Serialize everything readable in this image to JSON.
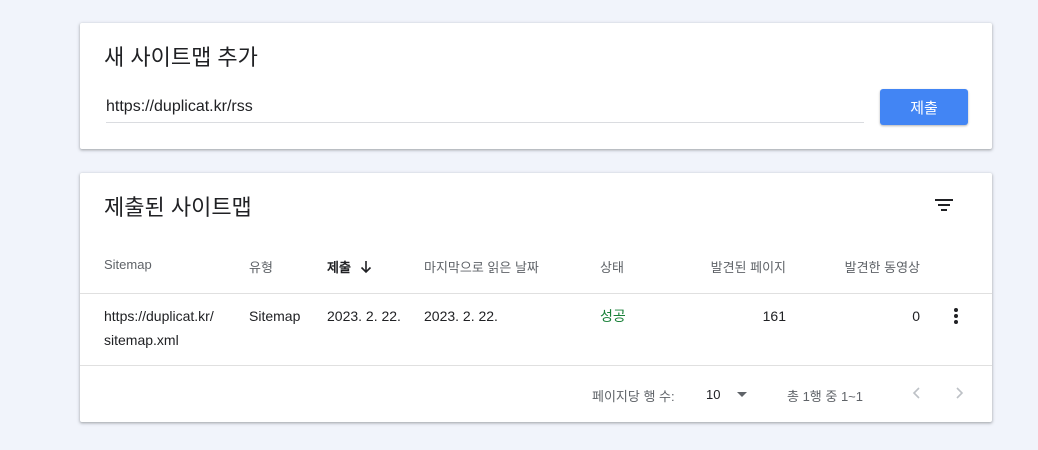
{
  "add_sitemap": {
    "title": "새 사이트맵 추가",
    "input_value": "https://duplicat.kr/rss",
    "submit_label": "제출"
  },
  "submitted": {
    "title": "제출된 사이트맵",
    "columns": [
      "Sitemap",
      "유형",
      "제출",
      "마지막으로 읽은 날짜",
      "상태",
      "발견된 페이지",
      "발견한 동영상"
    ],
    "sort_column": "제출",
    "rows": [
      {
        "sitemap_line1": "https://duplicat.kr/",
        "sitemap_line2": "sitemap.xml",
        "type": "Sitemap",
        "submitted": "2023. 2. 22.",
        "last_read": "2023. 2. 22.",
        "status": "성공",
        "pages": "161",
        "videos": "0"
      }
    ],
    "footer": {
      "rows_per_page_label": "페이지당 행 수:",
      "rows_per_page_value": "10",
      "range_text": "총 1행 중 1~1"
    }
  },
  "colors": {
    "accent": "#4285f4",
    "success": "#188038",
    "background": "#f1f4fb"
  },
  "icons": [
    "filter-icon",
    "arrow-down-icon",
    "more-vert-icon",
    "dropdown-caret-icon",
    "chevron-left-icon",
    "chevron-right-icon"
  ]
}
